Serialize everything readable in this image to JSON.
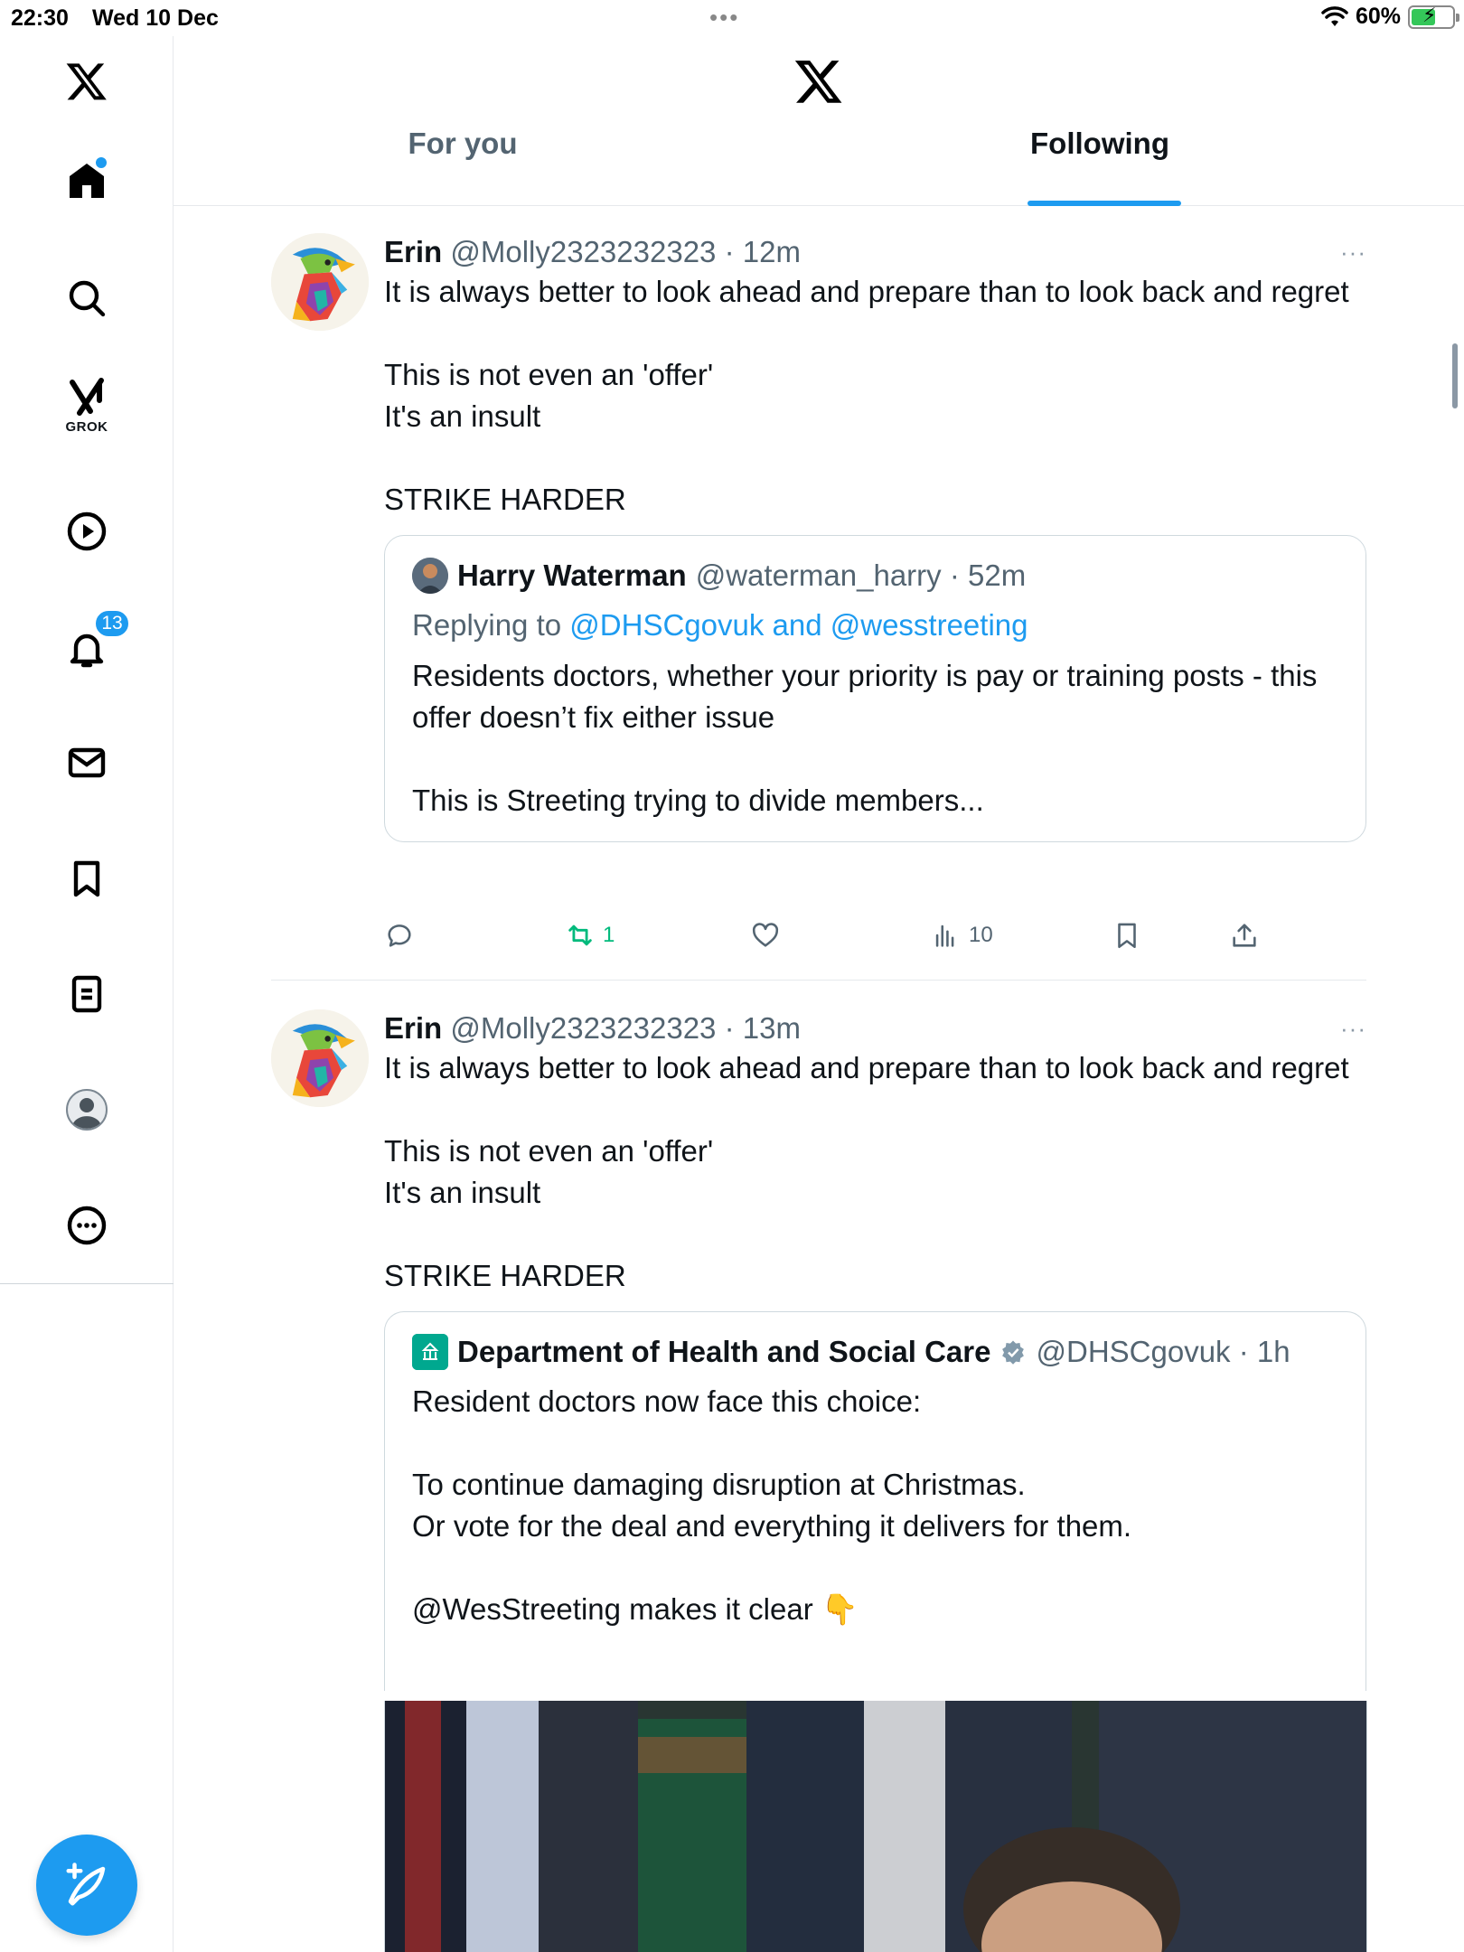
{
  "status_bar": {
    "time": "22:30",
    "date": "Wed 10 Dec",
    "battery": "60%",
    "battery_level": 0.6
  },
  "sidebar": {
    "grok_label": "GROK",
    "notifications_count": "13",
    "accent_color": "#1d9bf0"
  },
  "header": {
    "tabs": [
      {
        "label": "For you",
        "active": false
      },
      {
        "label": "Following",
        "active": true
      }
    ]
  },
  "posts": [
    {
      "name": "Erin",
      "handle": "@Molly2323232323",
      "time": "12m",
      "more": "···",
      "text": [
        "It is always better to look ahead and prepare than to look back and regret",
        "",
        "This is not even an 'offer'",
        "It's an insult",
        "",
        "STRIKE HARDER"
      ],
      "quote": {
        "name": "Harry Waterman",
        "handle": "@waterman_harry",
        "time": "52m",
        "replying_prefix": "Replying to",
        "replying_mentions": "@DHSCgovuk and @wesstreeting",
        "text": [
          "Residents doctors, whether your priority is pay or training posts - this offer doesn’t fix either issue",
          "",
          "This is Streeting trying to divide members..."
        ]
      },
      "actions": {
        "replies": "",
        "reposts": "1",
        "likes": "",
        "views": "10"
      }
    },
    {
      "name": "Erin",
      "handle": "@Molly2323232323",
      "time": "13m",
      "more": "···",
      "text": [
        "It is always better to look ahead and prepare than to look back and regret",
        "",
        "This is not even an 'offer'",
        "It's an insult",
        "",
        "STRIKE HARDER"
      ],
      "quote": {
        "name": "Department of Health and Social Care",
        "verified": true,
        "handle": "@DHSCgovuk",
        "time": "1h",
        "text": [
          "Resident doctors now face this choice:",
          "",
          "To continue damaging disruption at Christmas.",
          "Or vote for the deal and everything it delivers for them.",
          "",
          "@WesStreeting makes it clear 👇"
        ]
      }
    }
  ]
}
